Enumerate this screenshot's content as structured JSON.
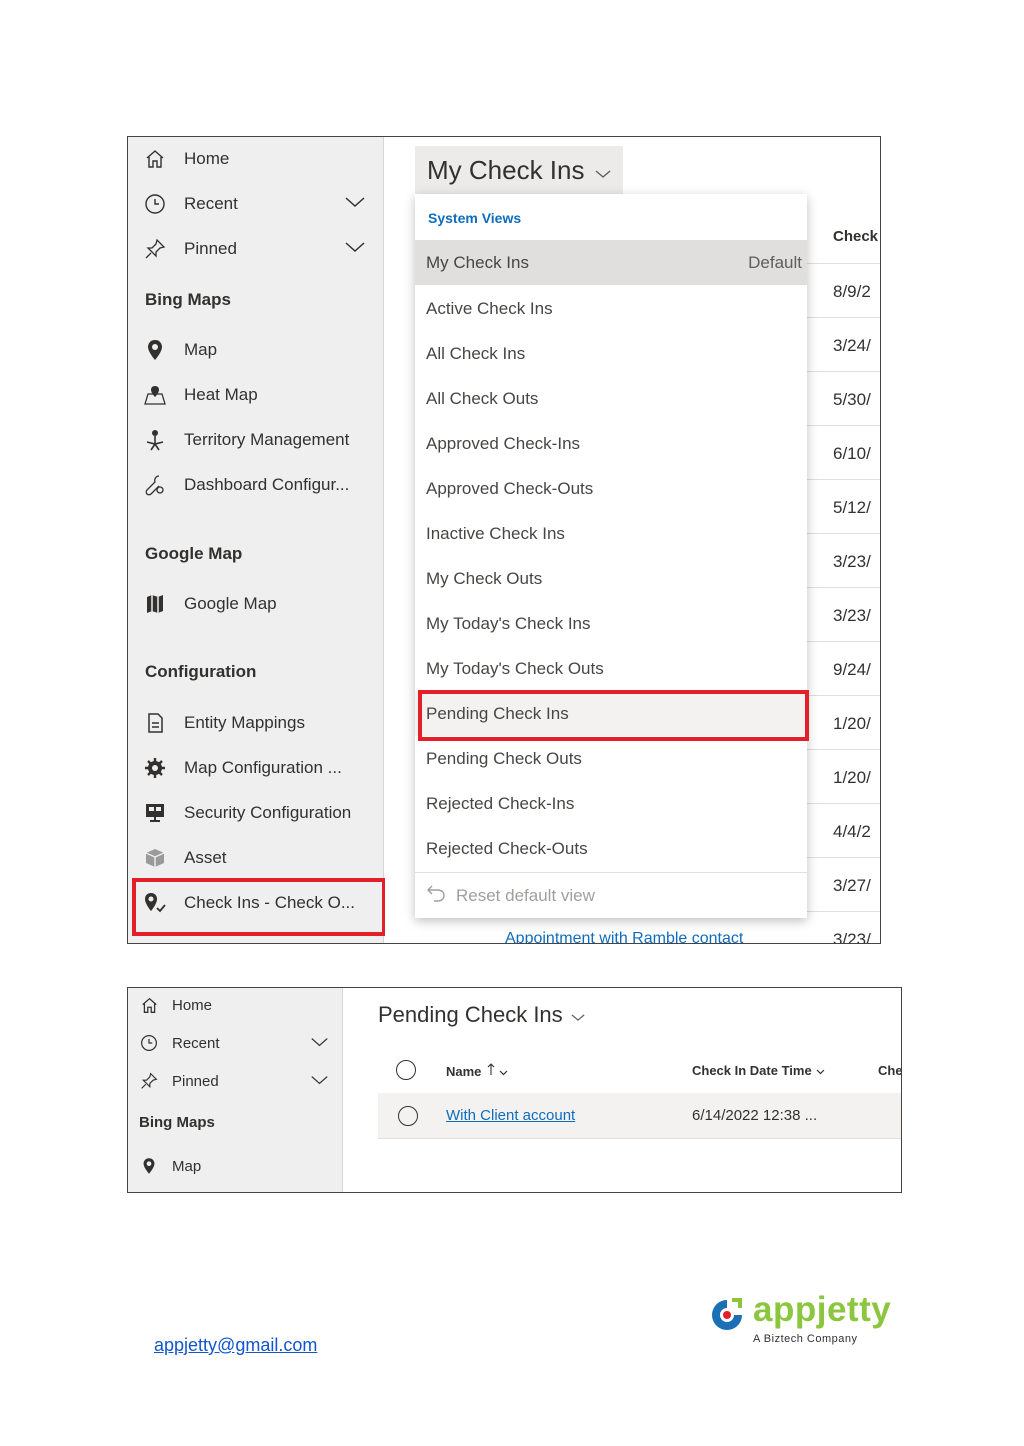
{
  "shot1": {
    "sidebar": {
      "home": "Home",
      "recent": "Recent",
      "pinned": "Pinned",
      "group_bing": "Bing Maps",
      "map": "Map",
      "heat_map": "Heat Map",
      "territory": "Territory Management",
      "dashboard": "Dashboard Configur...",
      "group_google": "Google Map",
      "google_map": "Google Map",
      "group_config": "Configuration",
      "entity_mappings": "Entity Mappings",
      "map_configuration": "Map Configuration ...",
      "security_configuration": "Security Configuration",
      "asset": "Asset",
      "check_ins": "Check Ins - Check O..."
    },
    "view_title": "My Check Ins",
    "column_header": "Check",
    "dates": [
      "8/9/2",
      "3/24/",
      "5/30/",
      "6/10/",
      "5/12/",
      "3/23/",
      "3/23/",
      "9/24/",
      "1/20/",
      "1/20/",
      "4/4/2",
      "3/27/",
      "3/23/"
    ],
    "bottom_link": "Appointment with Ramble contact",
    "dropdown": {
      "header": "System Views",
      "default_label": "Default",
      "items": [
        "My Check Ins",
        "Active Check Ins",
        "All Check Ins",
        "All Check Outs",
        "Approved Check-Ins",
        "Approved Check-Outs",
        "Inactive Check Ins",
        "My Check Outs",
        "My Today's Check Ins",
        "My Today's Check Outs",
        "Pending Check Ins",
        "Pending Check Outs",
        "Rejected Check-Ins",
        "Rejected Check-Outs"
      ],
      "reset": "Reset default view"
    }
  },
  "shot2": {
    "sidebar": {
      "home": "Home",
      "recent": "Recent",
      "pinned": "Pinned",
      "group_bing": "Bing Maps",
      "map": "Map"
    },
    "view_title": "Pending Check Ins",
    "columns": {
      "name": "Name",
      "check_in_date": "Check In Date Time",
      "next": "Che"
    },
    "row": {
      "name": "With Client account",
      "check_in_date": "6/14/2022 12:38 ..."
    }
  },
  "footer": {
    "email": "appjetty@gmail.com",
    "logo_word": "appjetty",
    "logo_sub": "A Biztech Company"
  },
  "colors": {
    "highlight": "#e3202a",
    "link": "#0f6cbd",
    "brand_green": "#8cc63f",
    "brand_blue": "#1a6fb5"
  }
}
